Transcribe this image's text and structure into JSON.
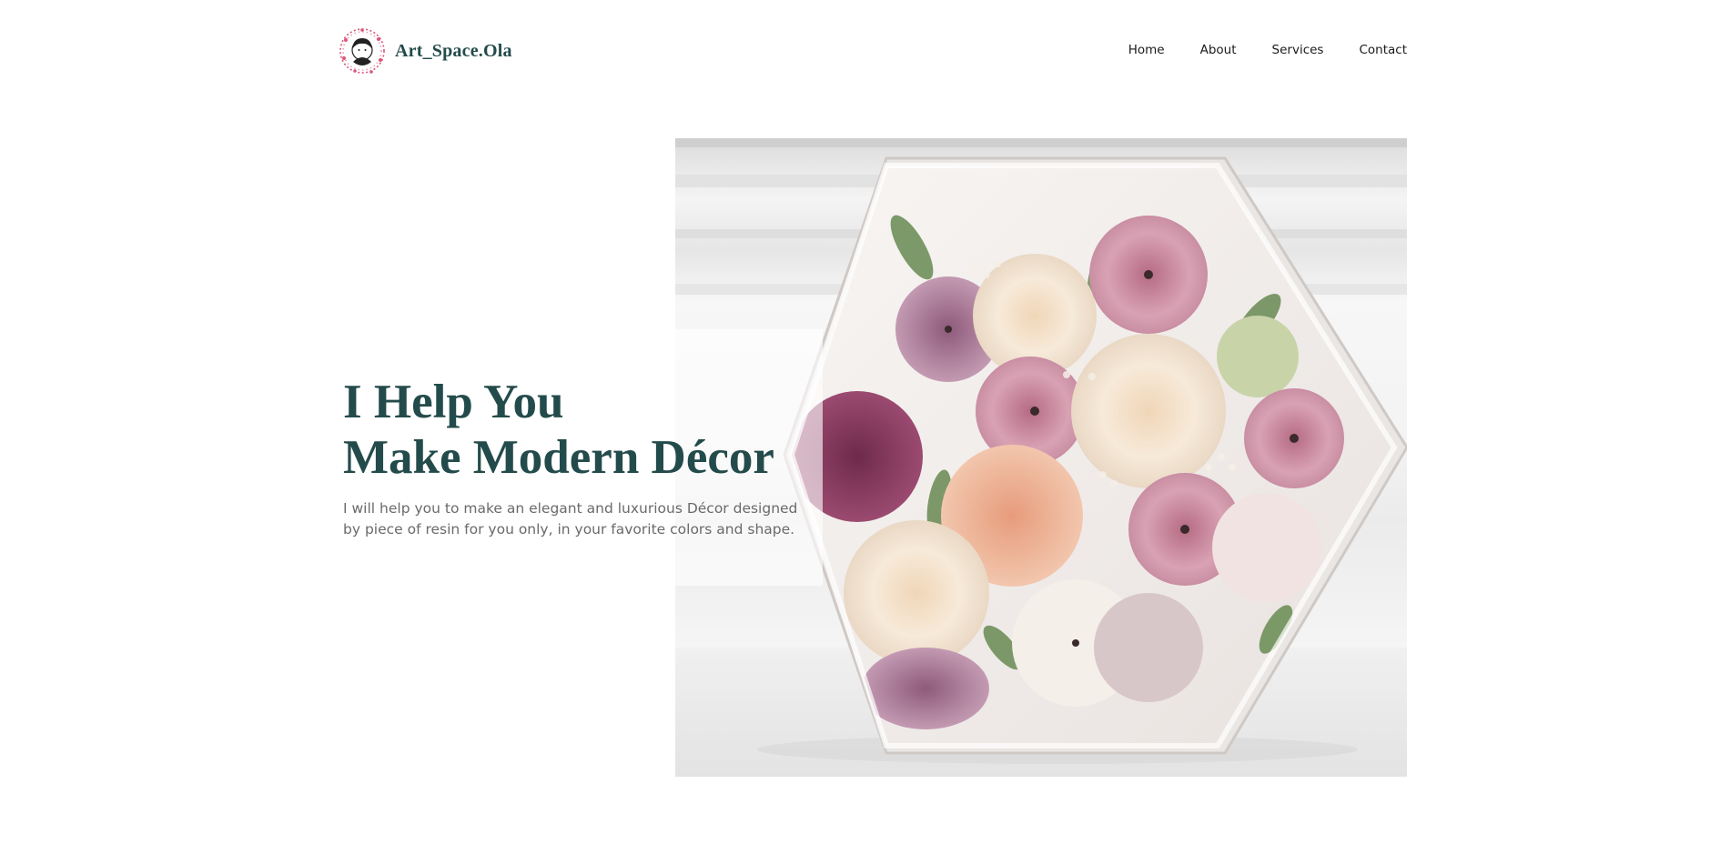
{
  "header": {
    "brand": "Art_Space.Ola",
    "logo_icon": "wreath-portrait-icon",
    "nav": [
      {
        "label": "Home"
      },
      {
        "label": "About"
      },
      {
        "label": "Services"
      },
      {
        "label": "Contact"
      }
    ]
  },
  "hero": {
    "headline_line1": "I Help You",
    "headline_line2": "Make Modern Décor",
    "subtitle": "I will help you to make an elegant and luxurious Décor designed by piece of resin for you only, in your favorite colors and shape.",
    "image_subject": "hexagonal-resin-flower-block-image"
  },
  "colors": {
    "brand_text": "#244b4b",
    "body_text": "#6a6a6a",
    "nav_text": "#1a1a1a",
    "logo_accent": "#d9577a"
  }
}
